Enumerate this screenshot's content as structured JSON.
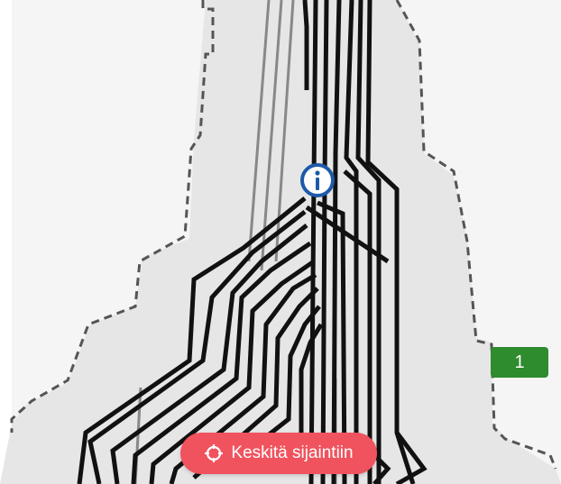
{
  "map": {
    "colors": {
      "background": "#f5f5f5",
      "area_fill": "#e6e6e6",
      "boundary": "#555555",
      "track": "#111111",
      "track_minor": "#888888"
    }
  },
  "info_marker": {
    "icon": "info-icon",
    "color": "#1e5aa8"
  },
  "count_badge": {
    "label": "1",
    "color": "#2e8b2e"
  },
  "center_button": {
    "label": "Keskitä sijaintiin",
    "icon": "crosshair-icon",
    "color": "#f0535e"
  }
}
